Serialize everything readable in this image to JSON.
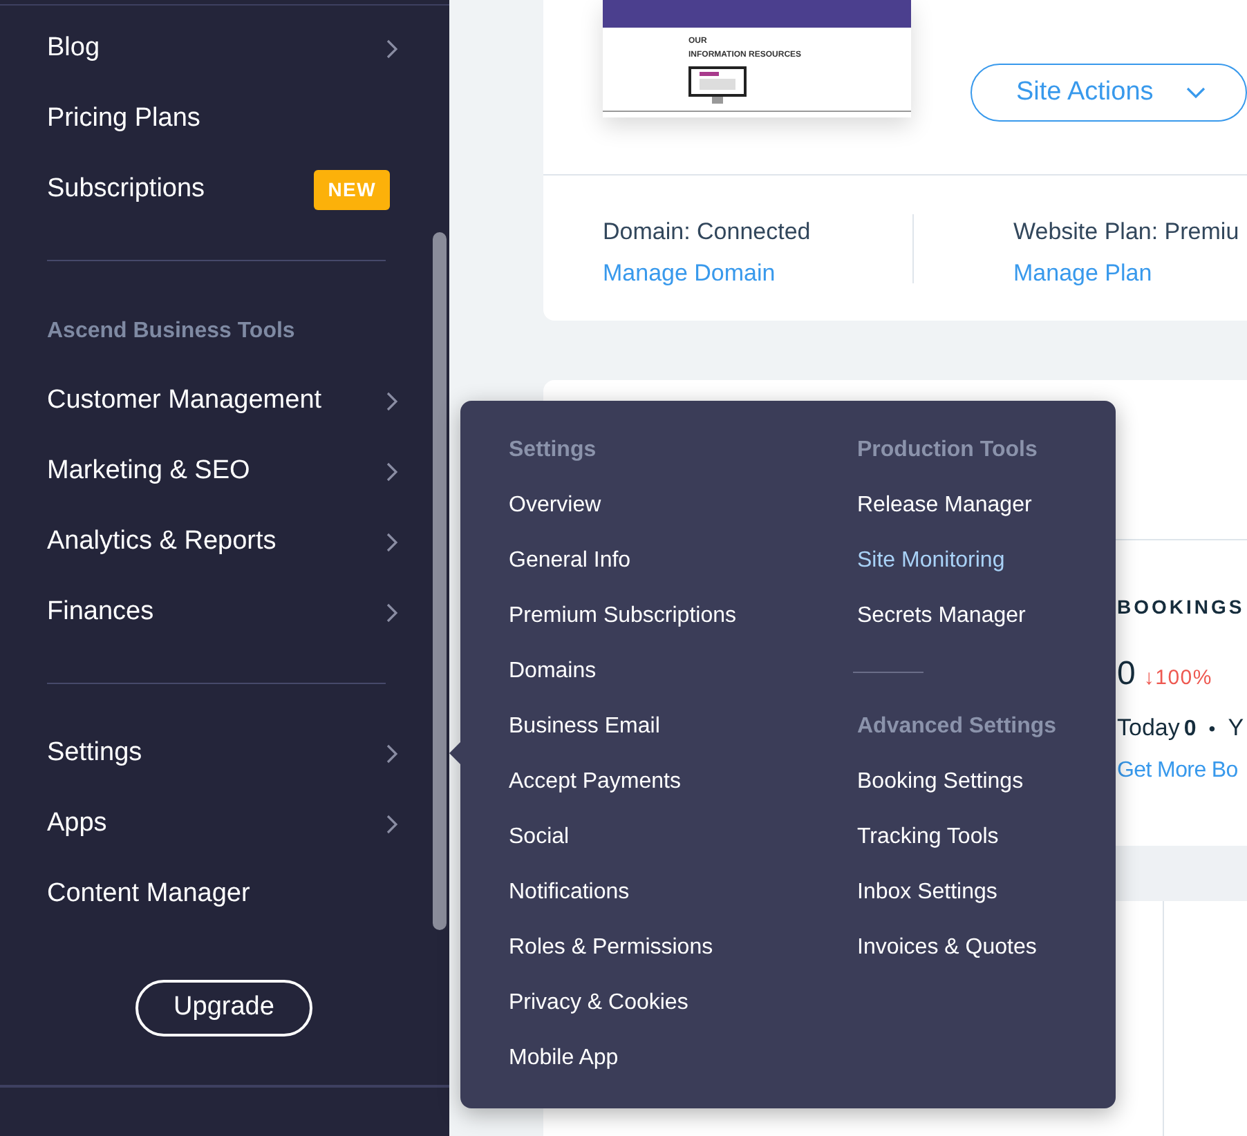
{
  "sidebar": {
    "top_items": [
      {
        "label": "Blog",
        "has_arrow": true
      },
      {
        "label": "Pricing Plans",
        "has_arrow": false
      },
      {
        "label": "Subscriptions",
        "has_arrow": false,
        "badge": "NEW"
      }
    ],
    "section_title": "Ascend Business Tools",
    "section_items": [
      {
        "label": "Customer Management",
        "has_arrow": true
      },
      {
        "label": "Marketing & SEO",
        "has_arrow": true
      },
      {
        "label": "Analytics & Reports",
        "has_arrow": true
      },
      {
        "label": "Finances",
        "has_arrow": true
      }
    ],
    "bottom_items": [
      {
        "label": "Settings",
        "has_arrow": true
      },
      {
        "label": "Apps",
        "has_arrow": true
      },
      {
        "label": "Content Manager",
        "has_arrow": false
      }
    ],
    "upgrade_button": "Upgrade"
  },
  "site_card": {
    "thumbnail": {
      "heading_line_1": "OUR",
      "heading_line_2": "INFORMATION RESOURCES"
    },
    "site_actions_button": "Site Actions",
    "domain_status": "Domain: Connected",
    "domain_link": "Manage Domain",
    "plan_status": "Website Plan: Premiu",
    "plan_link": "Manage Plan"
  },
  "bookings": {
    "title": "BOOKINGS",
    "value": "0",
    "change": "↓100%",
    "today_label": "Today",
    "today_value": "0",
    "separator": "•",
    "next_label": "Y",
    "link": "Get More Bo"
  },
  "settings_menu": {
    "columns": [
      {
        "groups": [
          {
            "title": "Settings",
            "items": [
              {
                "label": "Overview",
                "highlighted": false
              },
              {
                "label": "General Info",
                "highlighted": false
              },
              {
                "label": "Premium Subscriptions",
                "highlighted": false
              },
              {
                "label": "Domains",
                "highlighted": false
              },
              {
                "label": "Business Email",
                "highlighted": false
              },
              {
                "label": "Accept Payments",
                "highlighted": false
              },
              {
                "label": "Social",
                "highlighted": false
              },
              {
                "label": "Notifications",
                "highlighted": false
              },
              {
                "label": "Roles & Permissions",
                "highlighted": false
              },
              {
                "label": "Privacy & Cookies",
                "highlighted": false
              },
              {
                "label": "Mobile App",
                "highlighted": false
              }
            ]
          }
        ]
      },
      {
        "groups": [
          {
            "title": "Production Tools",
            "items": [
              {
                "label": "Release Manager",
                "highlighted": false
              },
              {
                "label": "Site Monitoring",
                "highlighted": true
              },
              {
                "label": "Secrets Manager",
                "highlighted": false
              }
            ]
          },
          {
            "title": "Advanced Settings",
            "items": [
              {
                "label": "Booking Settings",
                "highlighted": false
              },
              {
                "label": "Tracking Tools",
                "highlighted": false
              },
              {
                "label": "Inbox Settings",
                "highlighted": false
              },
              {
                "label": "Invoices & Quotes",
                "highlighted": false
              }
            ]
          }
        ]
      }
    ]
  }
}
